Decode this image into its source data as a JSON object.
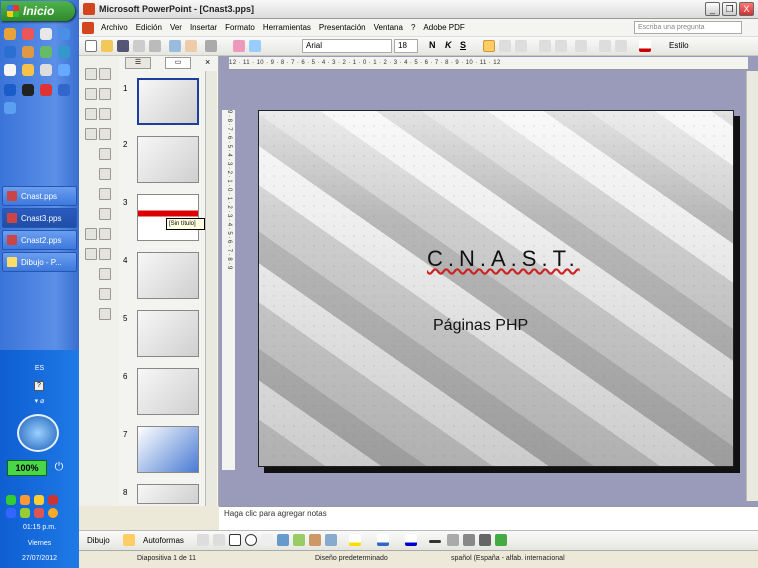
{
  "taskbar": {
    "start_label": "Inicio",
    "tasks": [
      {
        "label": "Cnast.pps"
      },
      {
        "label": "Cnast3.pps"
      },
      {
        "label": "Cnast2.pps"
      },
      {
        "label": "Dibujo - P..."
      }
    ],
    "tray": {
      "lang": "ES",
      "help": "?",
      "battery": "100%",
      "time": "01:15 p.m.",
      "day": "Viernes",
      "date": "27/07/2012"
    }
  },
  "window": {
    "title": "Microsoft PowerPoint - [Cnast3.pps]",
    "controls": {
      "min": "_",
      "max": "❐",
      "close": "X"
    }
  },
  "menu": {
    "items": [
      "Archivo",
      "Edición",
      "Ver",
      "Insertar",
      "Formato",
      "Herramientas",
      "Presentación",
      "Ventana",
      "?",
      "Adobe PDF"
    ],
    "ask_placeholder": "Escriba una pregunta"
  },
  "toolbar": {
    "font": "Arial",
    "size": "18",
    "bold": "N",
    "italic": "K",
    "shadow": "S",
    "style_label": "Estilo"
  },
  "slides_panel": {
    "numbers": [
      "1",
      "2",
      "3",
      "4",
      "5",
      "6",
      "7",
      "8"
    ],
    "tooltip": "[Sin título]"
  },
  "ruler": {
    "horizontal": "12 · 11 · 10 · 9 · 8 · 7 · 6 · 5 · 4 · 3 · 2 · 1 · 0 · 1 · 2 · 3 · 4 · 5 · 6 · 7 · 8 · 9 · 10 · 11 · 12",
    "vertical": "9 · 8 · 7 · 6 · 5 · 4 · 3 · 2 · 1 · 0 · 1 · 2 · 3 · 4 · 5 · 6 · 7 · 8 · 9"
  },
  "slide": {
    "title": "C.N.A.S.T.",
    "subtitle": "Páginas PHP"
  },
  "notes": {
    "placeholder": "Haga clic para agregar notas"
  },
  "drawbar": {
    "dibujo": "Dibujo",
    "autoformas": "Autoformas"
  },
  "status": {
    "slide": "Diapositiva 1 de 11",
    "design": "Diseño predeterminado",
    "language": "spañol (España - alfab. internacional"
  },
  "colors": {
    "accent": "#1b3f9a",
    "taskbar": "#3b74d8",
    "start": "#3f9e3b"
  }
}
